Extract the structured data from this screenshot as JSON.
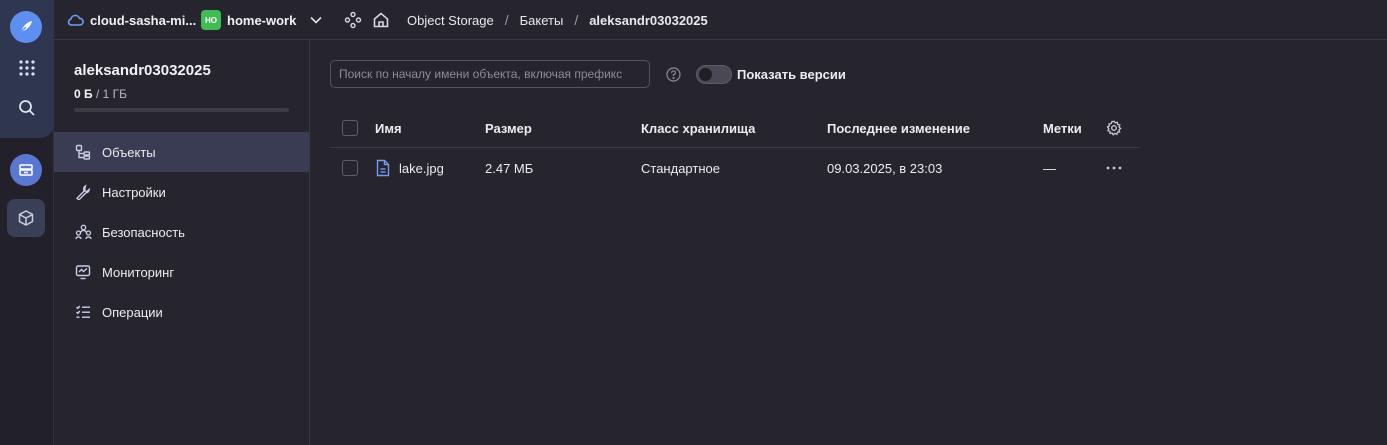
{
  "topbar": {
    "cloud_name": "cloud-sasha-mi...",
    "folder_badge": "НО",
    "folder_name": "home-work",
    "breadcrumbs": [
      "Object Storage",
      "Бакеты",
      "aleksandr03032025"
    ],
    "separator": "/"
  },
  "sidebar": {
    "bucket_name": "aleksandr03032025",
    "usage_used": "0 Б",
    "usage_limit": "/ 1 ГБ",
    "usage_fraction": 0,
    "items": [
      {
        "label": "Объекты",
        "icon": "objects-icon",
        "active": true
      },
      {
        "label": "Настройки",
        "icon": "wrench-icon",
        "active": false
      },
      {
        "label": "Безопасность",
        "icon": "users-icon",
        "active": false
      },
      {
        "label": "Мониторинг",
        "icon": "monitor-icon",
        "active": false
      },
      {
        "label": "Операции",
        "icon": "list-icon",
        "active": false
      }
    ]
  },
  "toolbar": {
    "search_placeholder": "Поиск по началу имени объекта, включая префикс",
    "search_value": "",
    "show_versions_label": "Показать версии",
    "show_versions_on": false
  },
  "table": {
    "columns": [
      "Имя",
      "Размер",
      "Класс хранилища",
      "Последнее изменение",
      "Метки"
    ],
    "rows": [
      {
        "name": "lake.jpg",
        "size": "2.47 МБ",
        "storage_class": "Стандартное",
        "modified": "09.03.2025, в 23:03",
        "labels": "—"
      }
    ]
  },
  "colors": {
    "background": "#26252d",
    "accent": "#5d8ff0",
    "folder_badge": "#3fbd53",
    "active_nav": "#393c52"
  }
}
